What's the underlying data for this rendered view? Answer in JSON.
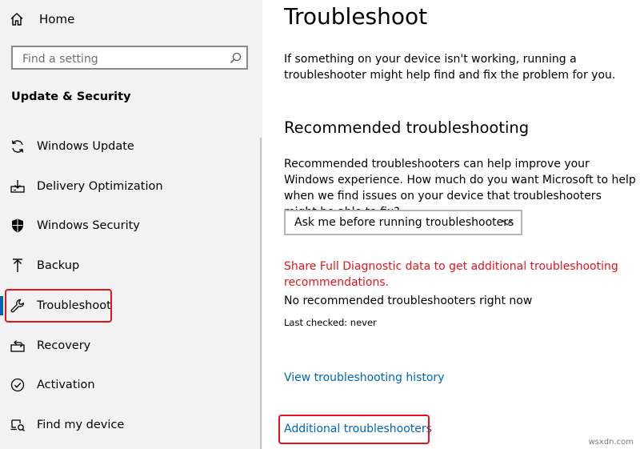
{
  "sidebar": {
    "home_label": "Home",
    "search_placeholder": "Find a setting",
    "section_title": "Update & Security",
    "items": [
      {
        "label": "Windows Update",
        "icon": "sync-icon"
      },
      {
        "label": "Delivery Optimization",
        "icon": "delivery-optimization-icon"
      },
      {
        "label": "Windows Security",
        "icon": "shield-icon"
      },
      {
        "label": "Backup",
        "icon": "backup-arrow-icon"
      },
      {
        "label": "Troubleshoot",
        "icon": "wrench-icon"
      },
      {
        "label": "Recovery",
        "icon": "recovery-icon"
      },
      {
        "label": "Activation",
        "icon": "activation-check-icon"
      },
      {
        "label": "Find my device",
        "icon": "find-device-icon"
      }
    ],
    "active_index": 4
  },
  "main": {
    "title": "Troubleshoot",
    "intro": "If something on your device isn't working, running a troubleshooter might help find and fix the problem for you.",
    "recommended_title": "Recommended troubleshooting",
    "recommended_desc": "Recommended troubleshooters can help improve your Windows experience. How much do you want Microsoft to help when we find issues on your device that troubleshooters might be able to fix?",
    "dropdown_value": "Ask me before running troubleshooters",
    "diagnostic_link": "Share Full Diagnostic data to get additional troubleshooting recommendations.",
    "no_recommended": "No recommended troubleshooters right now",
    "last_checked": "Last checked: never",
    "history_link": "View troubleshooting history",
    "additional_link": "Additional troubleshooters"
  },
  "watermark": "wsxdn.com",
  "colors": {
    "accent": "#0067b8",
    "highlight_box": "#e2141b",
    "warning_text": "#e2141b",
    "sidebar_bg": "#f2f2f2"
  }
}
